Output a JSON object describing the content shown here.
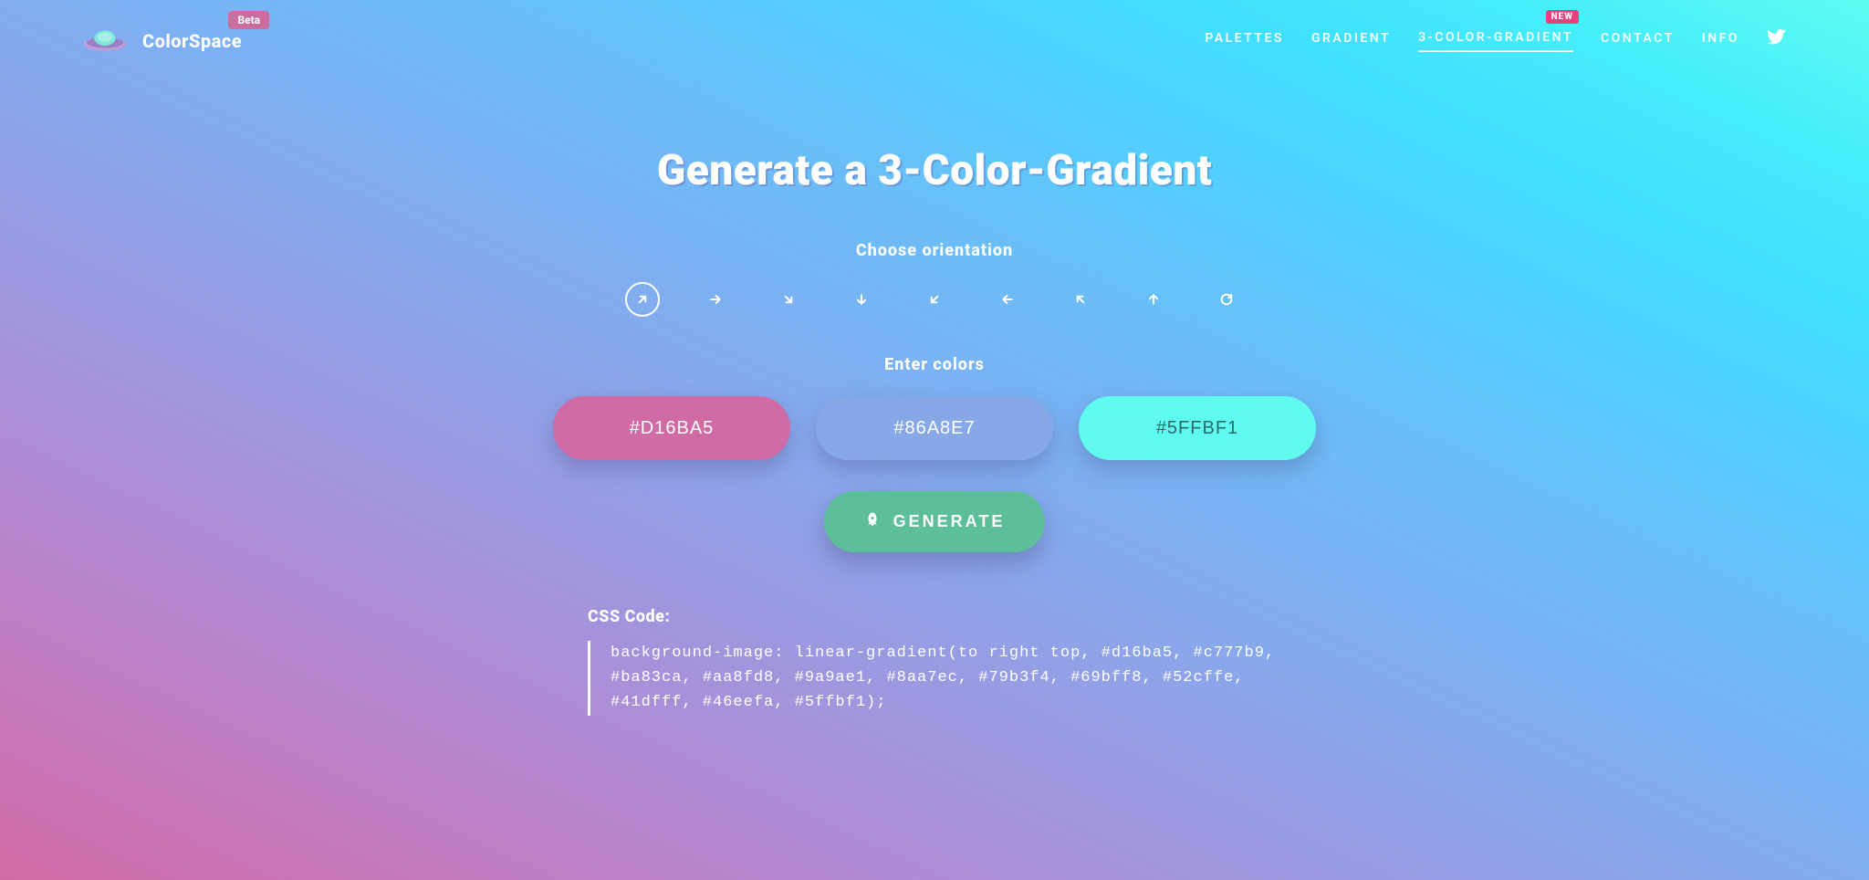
{
  "brand": {
    "name": "ColorSpace",
    "badge": "Beta"
  },
  "nav": {
    "items": [
      {
        "label": "PALETTES",
        "active": false,
        "new": false
      },
      {
        "label": "GRADIENT",
        "active": false,
        "new": false
      },
      {
        "label": "3-COLOR-GRADIENT",
        "active": true,
        "new": true
      },
      {
        "label": "CONTACT",
        "active": false,
        "new": false
      },
      {
        "label": "INFO",
        "active": false,
        "new": false
      }
    ],
    "new_badge": "NEW"
  },
  "main": {
    "title": "Generate a 3-Color-Gradient",
    "orientation_label": "Choose orientation",
    "orientations": [
      {
        "name": "right-top",
        "selected": true,
        "rotation": -45
      },
      {
        "name": "right",
        "selected": false,
        "rotation": 0
      },
      {
        "name": "right-bottom",
        "selected": false,
        "rotation": 45
      },
      {
        "name": "bottom",
        "selected": false,
        "rotation": 90
      },
      {
        "name": "left-bottom",
        "selected": false,
        "rotation": 135
      },
      {
        "name": "left",
        "selected": false,
        "rotation": 180
      },
      {
        "name": "left-top",
        "selected": false,
        "rotation": 225
      },
      {
        "name": "top",
        "selected": false,
        "rotation": 270
      },
      {
        "name": "circular",
        "selected": false,
        "rotation": null
      }
    ],
    "colors_label": "Enter colors",
    "color_inputs": [
      {
        "value": "#D16BA5",
        "bg": "#d16ba5"
      },
      {
        "value": "#86A8E7",
        "bg": "#86a8e7"
      },
      {
        "value": "#5FFBF1",
        "bg": "#5ffbf1"
      }
    ],
    "generate_label": "GENERATE",
    "css_label": "CSS Code:",
    "css_code": "background-image: linear-gradient(to right top, #d16ba5, #c777b9, #ba83ca, #aa8fd8, #9a9ae1, #8aa7ec, #79b3f4, #69bff8, #52cffe, #41dfff, #46eefa, #5ffbf1);"
  }
}
